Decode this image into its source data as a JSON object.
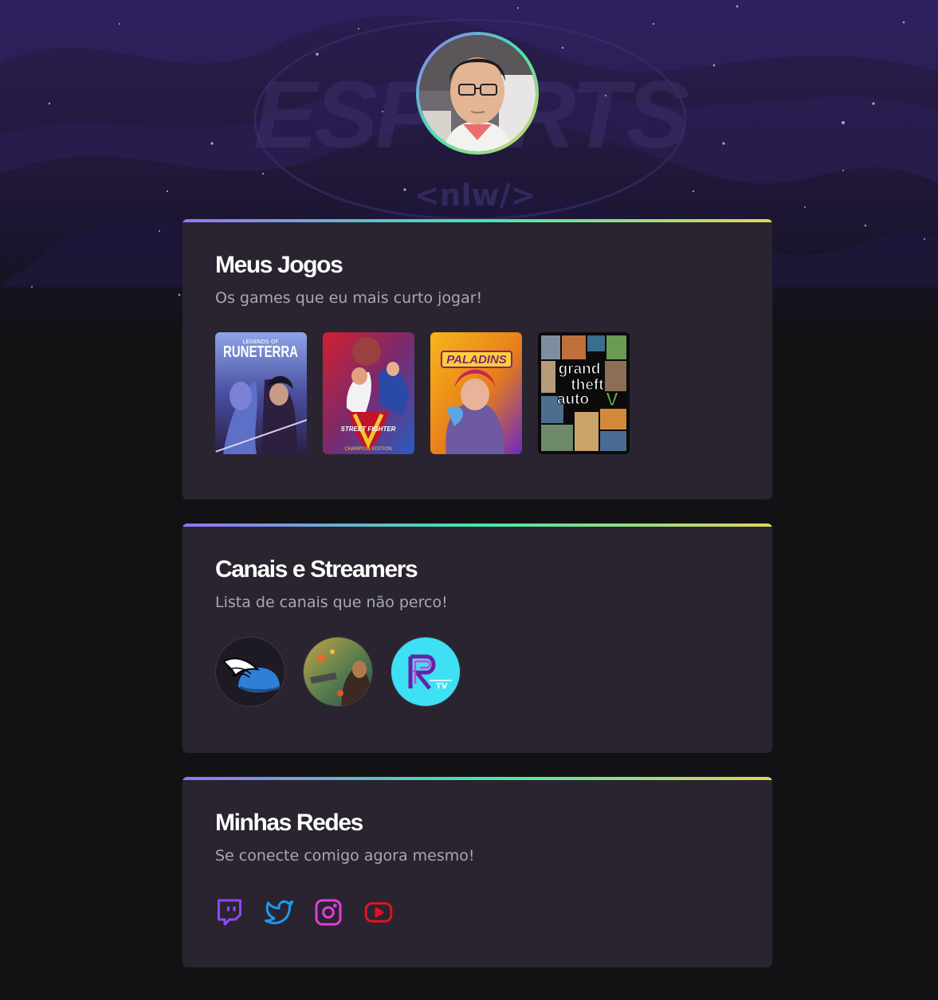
{
  "profile": {
    "avatar_alt": "avatar"
  },
  "background": {
    "watermark_text": "ESPORTS",
    "tag_text": "<nlw/>"
  },
  "sections": {
    "games": {
      "title": "Meus Jogos",
      "subtitle": "Os games que eu mais curto jogar!",
      "items": [
        {
          "name": "Legends of Runeterra",
          "cover_label_top": "LEGENDS OF",
          "cover_label": "RUNETERRA",
          "icon": "runeterra-cover"
        },
        {
          "name": "Street Fighter V Champion Edition",
          "cover_label": "STREET FIGHTER",
          "cover_sub": "CHAMPION EDITION",
          "icon": "street-fighter-cover"
        },
        {
          "name": "Paladins",
          "cover_label": "PALADINS",
          "icon": "paladins-cover"
        },
        {
          "name": "Grand Theft Auto V",
          "cover_label_1": "grand",
          "cover_label_2": "theft",
          "cover_label_3": "auto",
          "icon": "gta-cover"
        }
      ]
    },
    "streamers": {
      "title": "Canais e Streamers",
      "subtitle": "Lista de canais que não perco!",
      "items": [
        {
          "icon": "winged-helmet-avatar"
        },
        {
          "icon": "game-art-avatar"
        },
        {
          "icon": "rtv-logo-avatar"
        }
      ]
    },
    "socials": {
      "title": "Minhas Redes",
      "subtitle": "Se conecte comigo agora mesmo!",
      "items": [
        {
          "name": "Twitch",
          "icon": "twitch-icon",
          "color": "#9146ff"
        },
        {
          "name": "Twitter",
          "icon": "twitter-icon",
          "color": "#1d9bf0"
        },
        {
          "name": "Instagram",
          "icon": "instagram-icon",
          "color": "#e33ed8"
        },
        {
          "name": "YouTube",
          "icon": "youtube-icon",
          "color": "#e5121f"
        }
      ]
    }
  },
  "colors": {
    "page_bg": "#121214",
    "card_bg": "#29242f",
    "gradient": [
      "#9572fc",
      "#43e7ad",
      "#e2d45c"
    ],
    "title": "#ffffff",
    "subtitle": "#a8a8b3"
  }
}
